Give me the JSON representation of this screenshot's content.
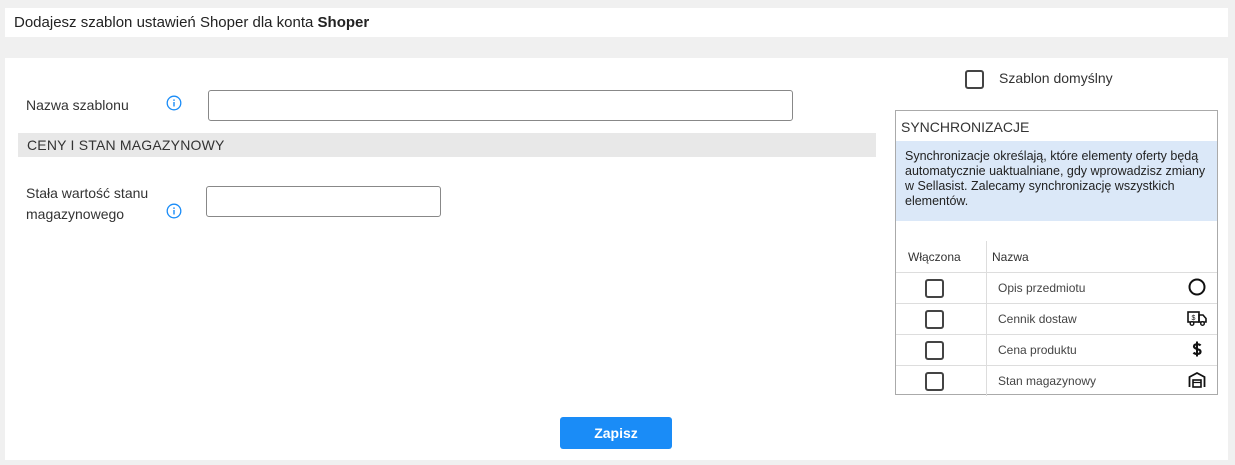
{
  "header": {
    "prefix": "Dodajesz szablon ustawień Shoper dla konta",
    "account": "Shoper"
  },
  "form": {
    "template_name_label": "Nazwa szablonu",
    "template_name_value": "",
    "section_prices_stock": "CENY I STAN MAGAZYNOWY",
    "fixed_stock_label_line1": "Stała wartość stanu",
    "fixed_stock_label_line2": "magazynowego",
    "fixed_stock_value": ""
  },
  "default_template": {
    "label": "Szablon domyślny",
    "checked": false
  },
  "sync": {
    "title": "SYNCHRONIZACJE",
    "description": "Synchronizacje określają, które elementy oferty będą automatycznie uaktualniane, gdy wprowadzisz zmiany w Sellasist. Zalecamy synchronizację wszystkich elementów.",
    "col_enabled": "Włączona",
    "col_name": "Nazwa",
    "rows": [
      {
        "name": "Opis przedmiotu",
        "icon": "circle-icon",
        "checked": false
      },
      {
        "name": "Cennik dostaw",
        "icon": "delivery-truck-icon",
        "checked": false
      },
      {
        "name": "Cena produktu",
        "icon": "dollar-icon",
        "checked": false
      },
      {
        "name": "Stan magazynowy",
        "icon": "warehouse-icon",
        "checked": false
      }
    ]
  },
  "actions": {
    "save_label": "Zapisz"
  },
  "colors": {
    "accent": "#1a8cf7",
    "info_icon": "#1a8cf7",
    "sync_desc_bg": "#dbe8f8"
  }
}
